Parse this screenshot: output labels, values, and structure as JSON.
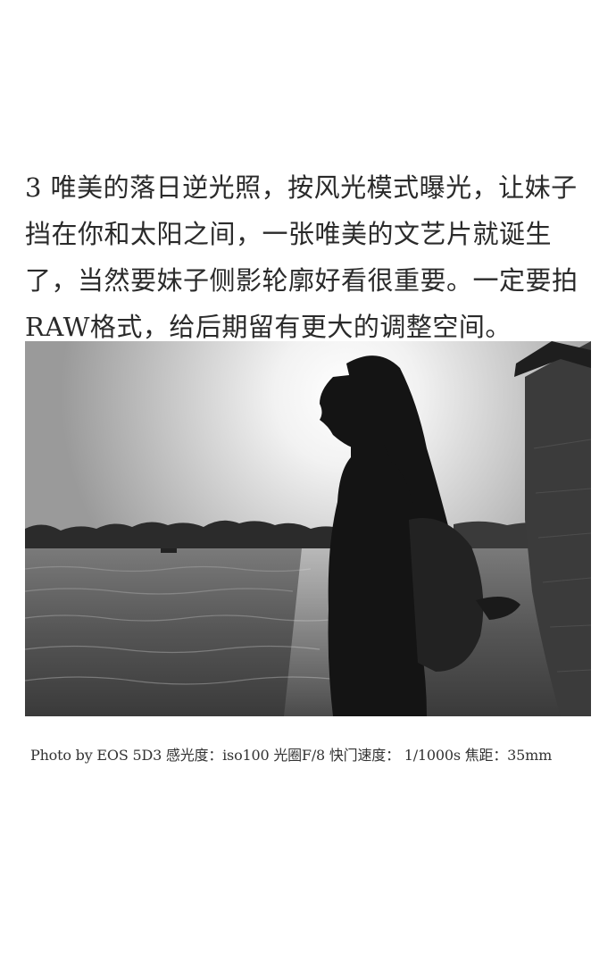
{
  "article": {
    "paragraph_lines": [
      "3  唯美的落日逆光照，按风光模式曝光，让妹子",
      "挡在你和太阳之间，一张唯美的文艺片就诞生",
      "了，当然要妹子侧影轮廓好看很重要。一定要拍",
      "RAW格式，给后期留有更大的调整空间。"
    ],
    "photo": {
      "subject": "silhouette-backlit-girl-lakeside",
      "tone": "black-and-white"
    },
    "caption": "Photo by EOS 5D3  感光度：iso100  光圈F/8   快门速度：  1/1000s  焦距：35mm"
  }
}
